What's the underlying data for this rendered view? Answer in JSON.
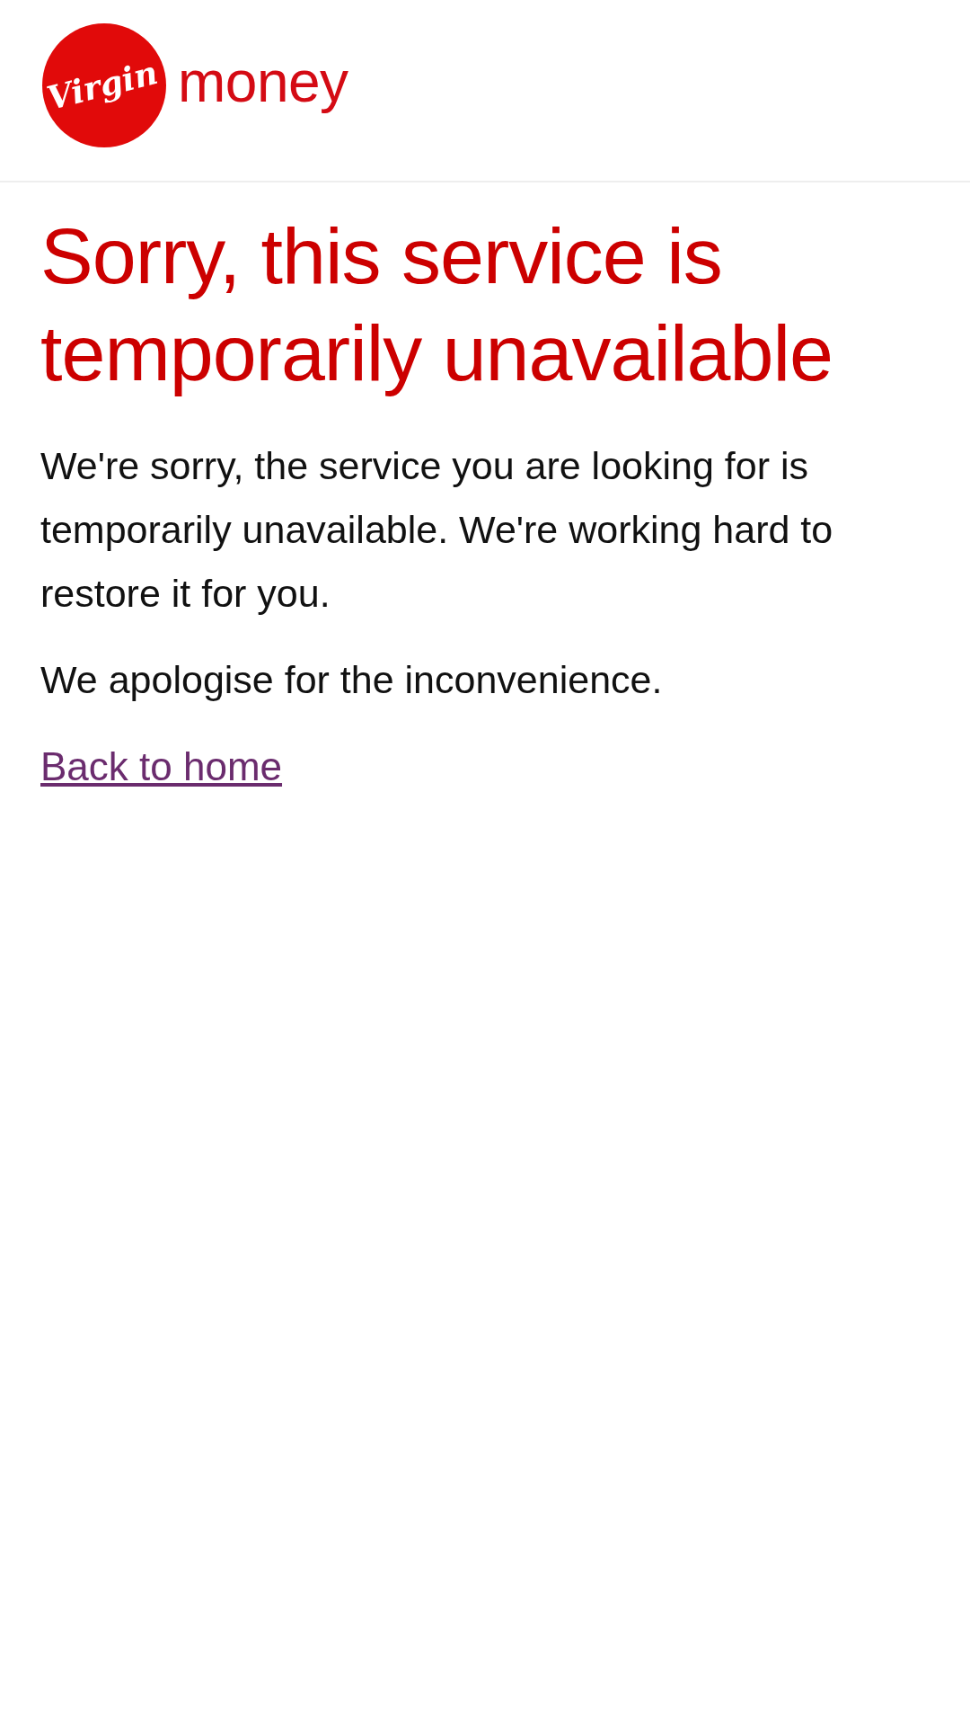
{
  "header": {
    "logo": {
      "badge_text": "Virgin",
      "wordmark": "money"
    }
  },
  "heading": "Sorry, this service is temporarily unavailable",
  "paragraphs": [
    "We're sorry, the service you are looking for is temporarily unavailable. We're working hard to restore it for you.",
    "We apologise for the inconvenience."
  ],
  "link": "Back to home"
}
